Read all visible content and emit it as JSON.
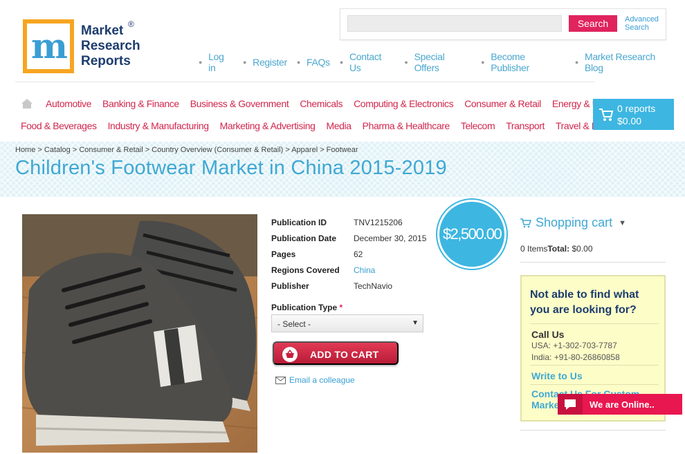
{
  "logo": {
    "letter": "m",
    "line1": "Market",
    "line2": "Research",
    "line3": "Reports",
    "reg": "®"
  },
  "search": {
    "placeholder": "",
    "button": "Search",
    "advanced": "Advanced Search"
  },
  "toplinks": [
    "Log in",
    "Register",
    "FAQs",
    "Contact Us",
    "Special Offers",
    "Become Publisher",
    "Market Research Blog"
  ],
  "categories_row1": [
    "Automotive",
    "Banking & Finance",
    "Business & Government",
    "Chemicals",
    "Computing & Electronics",
    "Consumer & Retail",
    "Energy & Utilities"
  ],
  "categories_row2": [
    "Food & Beverages",
    "Industry & Manufacturing",
    "Marketing & Advertising",
    "Media",
    "Pharma & Healthcare",
    "Telecom",
    "Transport",
    "Travel & Leisure"
  ],
  "cart": {
    "count": "0 reports",
    "total": "$0.00"
  },
  "breadcrumb": "Home > Catalog > Consumer & Retail > Country Overview (Consumer & Retail) > Apparel > Footwear",
  "title": "Children's Footwear Market in China 2015-2019",
  "details": {
    "publication_id_label": "Publication ID",
    "publication_id": "TNV1215206",
    "publication_date_label": "Publication Date",
    "publication_date": "December 30, 2015",
    "pages_label": "Pages",
    "pages": "62",
    "regions_label": "Regions Covered",
    "regions": "China",
    "publisher_label": "Publisher",
    "publisher": "TechNavio"
  },
  "price": "$2,500.00",
  "publication_type": {
    "label": "Publication Type",
    "required": "*",
    "selected": "- Select -"
  },
  "add_to_cart": "ADD TO CART",
  "email_colleague": "Email a colleague",
  "shopping_cart": {
    "title": "Shopping cart",
    "items": "0 Items",
    "total_label": "Total:",
    "total": "$0.00"
  },
  "help": {
    "title": "Not able to find what you are looking for?",
    "call_title": "Call Us",
    "usa": "USA: +1-302-703-7787",
    "india": "India: +91-80-26860858",
    "write": "Write to Us",
    "contact": "Contact Us For Custom Market"
  },
  "chat": "We are Online.."
}
